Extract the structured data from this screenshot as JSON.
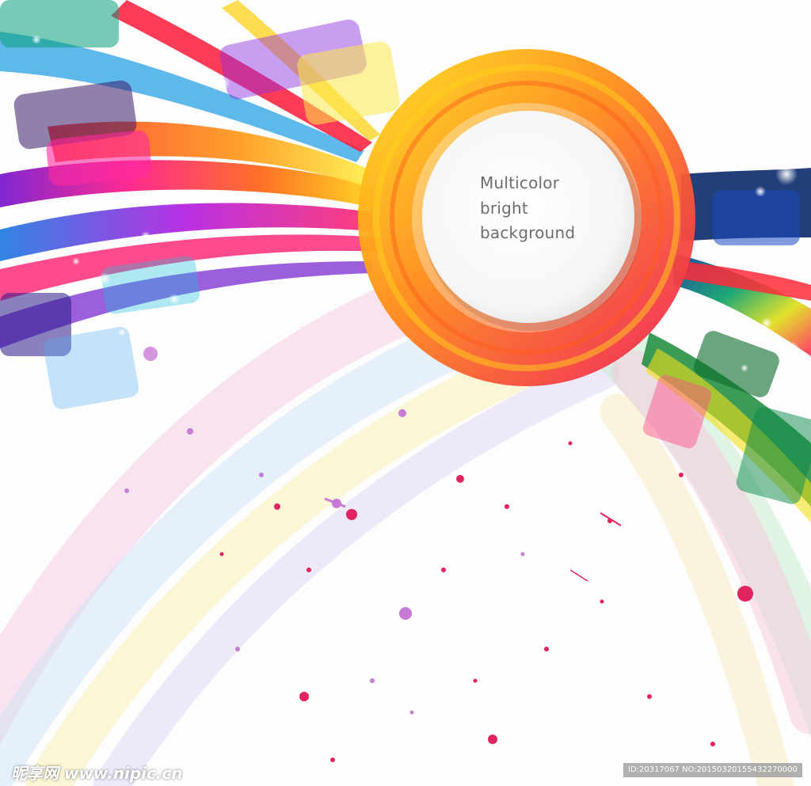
{
  "headline": {
    "line1": "Multicolor",
    "line2": "bright",
    "line3": "background"
  },
  "watermark": {
    "site_logo": "昵享网 www.nipic.cn",
    "id_text": "ID:20317067 NO:20150320155432270000"
  },
  "palette": {
    "ring_outer": "#f02a4a",
    "ring_inner": "#ffd21a",
    "splatter": "#e0245e",
    "splatter_alt": "#c77ad6"
  },
  "icons": [
    "circle-badge",
    "color-ribbons",
    "paint-splatter"
  ]
}
